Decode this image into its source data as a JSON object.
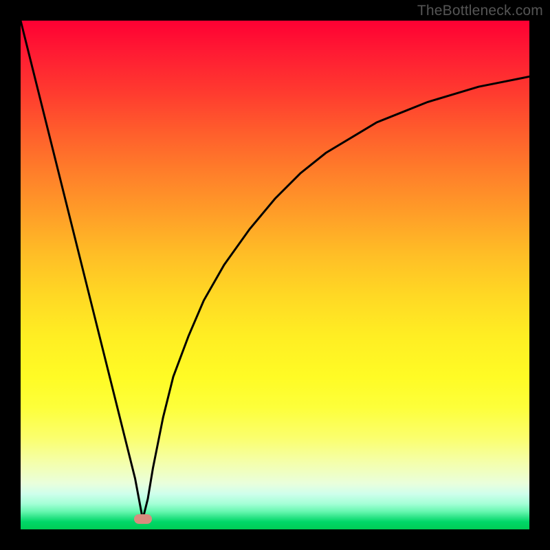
{
  "watermark": "TheBottleneck.com",
  "colors": {
    "frame": "#000000",
    "gradient_top": "#ff0033",
    "gradient_bottom": "#00cc55",
    "curve": "#000000",
    "marker": "#d98c7e"
  },
  "chart_data": {
    "type": "line",
    "title": "",
    "xlabel": "",
    "ylabel": "",
    "xlim": [
      0,
      100
    ],
    "ylim": [
      0,
      100
    ],
    "series": [
      {
        "name": "left-branch",
        "x": [
          0,
          2.5,
          5,
          7.5,
          10,
          12.5,
          15,
          17.5,
          20,
          22.5,
          24
        ],
        "values": [
          100,
          90,
          80,
          70,
          60,
          50,
          40,
          30,
          20,
          10,
          2
        ]
      },
      {
        "name": "right-branch",
        "x": [
          24,
          25,
          26,
          28,
          30,
          33,
          36,
          40,
          45,
          50,
          55,
          60,
          65,
          70,
          75,
          80,
          85,
          90,
          95,
          100
        ],
        "values": [
          2,
          6,
          12,
          22,
          30,
          38,
          45,
          52,
          59,
          65,
          70,
          74,
          77,
          80,
          82,
          84,
          85.5,
          87,
          88,
          89
        ]
      }
    ],
    "annotations": [
      {
        "name": "minimum-marker",
        "x": 24,
        "y": 2
      }
    ]
  }
}
